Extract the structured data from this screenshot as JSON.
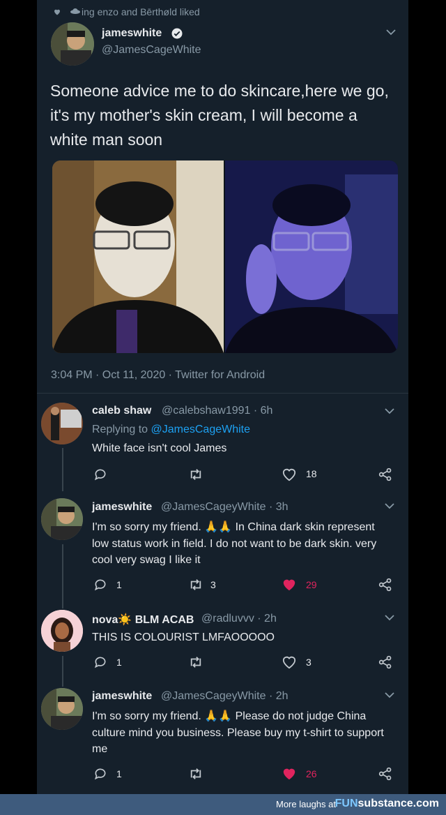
{
  "liked_banner": {
    "text": "ing enzo and Bērthøld liked"
  },
  "main_tweet": {
    "name": "jameswhite",
    "handle": "@JamesCageWhite",
    "text": "Someone advice me to do skincare,here we go, it's my mother's skin cream, I will become a white man soon",
    "timestamp": "3:04 PM · Oct 11, 2020 · Twitter for Android"
  },
  "replies": [
    {
      "name": "caleb shaw",
      "handle": "@calebshaw1991 · 6h",
      "replying_prefix": "Replying to ",
      "replying_to": "@JamesCageWhite",
      "text": "White face isn't cool James",
      "reply_count": "",
      "retweet_count": "",
      "like_count": "18",
      "liked": false
    },
    {
      "name": "jameswhite",
      "handle": "@JamesCageyWhite · 3h",
      "text": "I'm so sorry my friend. 🙏🙏 In China dark skin represent low status work in field.  I do not want to be dark skin.  very cool very swag I like it",
      "reply_count": "1",
      "retweet_count": "3",
      "like_count": "29",
      "liked": true
    },
    {
      "name": "nova☀️ BLM ACAB",
      "handle": "@radluvvv · 2h",
      "text": "THIS IS COLOURIST LMFAOOOOO",
      "reply_count": "1",
      "retweet_count": "",
      "like_count": "3",
      "liked": false
    },
    {
      "name": "jameswhite",
      "handle": "@JamesCageyWhite · 2h",
      "text": "I'm so sorry my friend. 🙏🙏 Please do not judge China culture mind you business.  Please buy my t-shirt to support me",
      "reply_count": "1",
      "retweet_count": "",
      "like_count": "26",
      "liked": true
    }
  ],
  "footer": {
    "text": "More laughs at",
    "brand_a": "FUN",
    "brand_b": "substance.com"
  },
  "colors": {
    "background": "#15202b",
    "like_active": "#e0245e",
    "link": "#1da1f2",
    "muted": "#8899a6"
  },
  "icons": [
    "heart-icon",
    "retweet-icon",
    "verified-icon",
    "chevron-down-icon",
    "reply-icon",
    "share-icon"
  ]
}
